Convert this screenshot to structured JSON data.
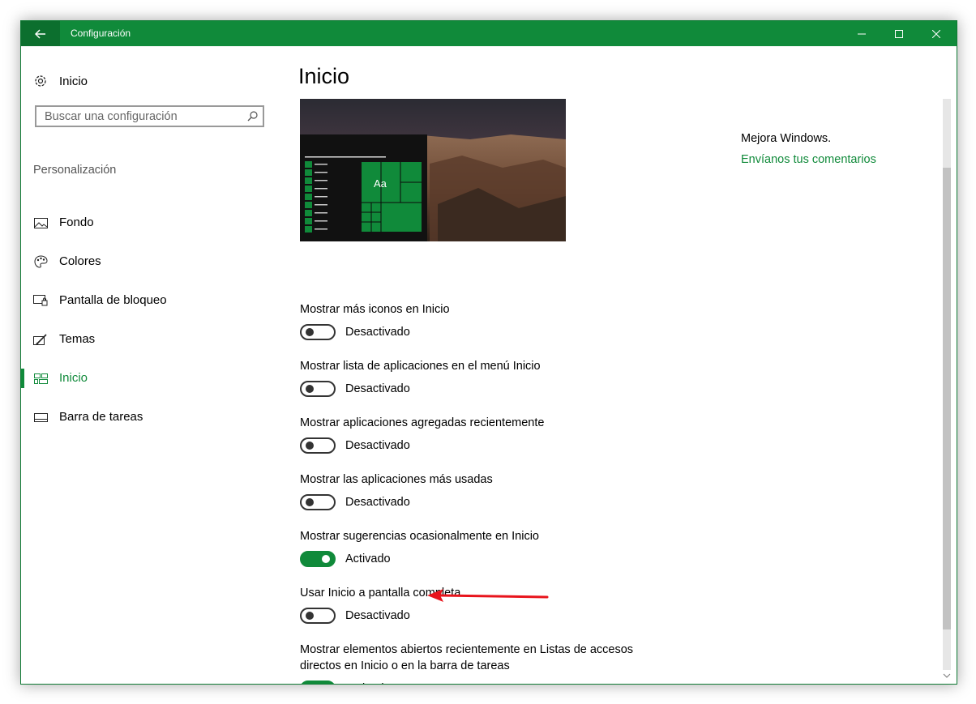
{
  "window": {
    "title": "Configuración",
    "accent": "#108a3a"
  },
  "sidebar": {
    "home_label": "Inicio",
    "search_placeholder": "Buscar una configuración",
    "section_label": "Personalización",
    "items": [
      {
        "label": "Fondo",
        "icon": "picture-icon",
        "active": false
      },
      {
        "label": "Colores",
        "icon": "palette-icon",
        "active": false
      },
      {
        "label": "Pantalla de bloqueo",
        "icon": "lock-screen-icon",
        "active": false
      },
      {
        "label": "Temas",
        "icon": "themes-icon",
        "active": false
      },
      {
        "label": "Inicio",
        "icon": "start-icon",
        "active": true
      },
      {
        "label": "Barra de tareas",
        "icon": "taskbar-icon",
        "active": false
      }
    ]
  },
  "main": {
    "title": "Inicio",
    "preview": {
      "tile_label": "Aa"
    },
    "settings": [
      {
        "label": "Mostrar más iconos en Inicio",
        "state": "Desactivado",
        "on": false
      },
      {
        "label": "Mostrar lista de aplicaciones en el menú Inicio",
        "state": "Desactivado",
        "on": false
      },
      {
        "label": "Mostrar aplicaciones agregadas recientemente",
        "state": "Desactivado",
        "on": false
      },
      {
        "label": "Mostrar las aplicaciones más usadas",
        "state": "Desactivado",
        "on": false
      },
      {
        "label": "Mostrar sugerencias ocasionalmente en Inicio",
        "state": "Activado",
        "on": true
      },
      {
        "label": "Usar Inicio a pantalla completa",
        "state": "Desactivado",
        "on": false
      },
      {
        "label": "Mostrar elementos abiertos recientemente en Listas de accesos directos en Inicio o en la barra de tareas",
        "state": "Activado",
        "on": true
      }
    ],
    "side_links": {
      "text": "Mejora Windows.",
      "link": "Envíanos tus comentarios"
    }
  },
  "annotation": {
    "color": "#e8141c"
  }
}
